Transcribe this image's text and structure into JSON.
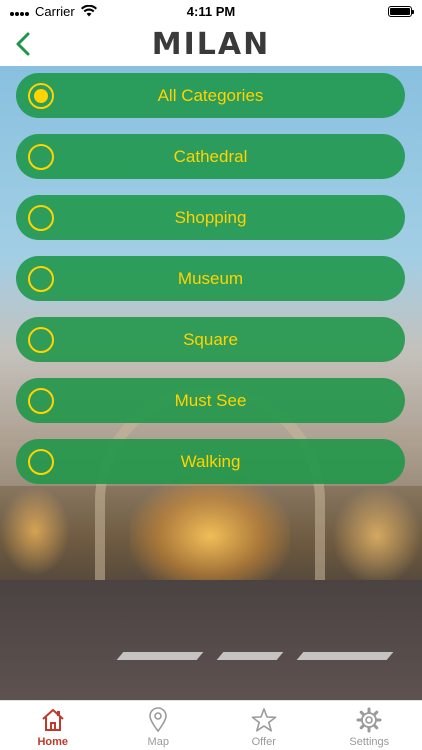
{
  "status_bar": {
    "carrier": "Carrier",
    "time": "4:11 PM"
  },
  "nav": {
    "title": "MILAN",
    "back_icon": "chevron-left-icon"
  },
  "categories": [
    {
      "label": "All Categories",
      "selected": true
    },
    {
      "label": "Cathedral",
      "selected": false
    },
    {
      "label": "Shopping",
      "selected": false
    },
    {
      "label": "Museum",
      "selected": false
    },
    {
      "label": "Square",
      "selected": false
    },
    {
      "label": "Must See",
      "selected": false
    },
    {
      "label": "Walking",
      "selected": false
    }
  ],
  "tabs": [
    {
      "label": "Home",
      "icon": "home-icon",
      "active": true
    },
    {
      "label": "Map",
      "icon": "map-pin-icon",
      "active": false
    },
    {
      "label": "Offer",
      "icon": "star-icon",
      "active": false
    },
    {
      "label": "Settings",
      "icon": "gear-icon",
      "active": false
    }
  ],
  "colors": {
    "accent_green": "#1c9648",
    "accent_yellow": "#ffd400",
    "active_tab": "#c0392b",
    "inactive_tab": "#9a9a9a"
  }
}
